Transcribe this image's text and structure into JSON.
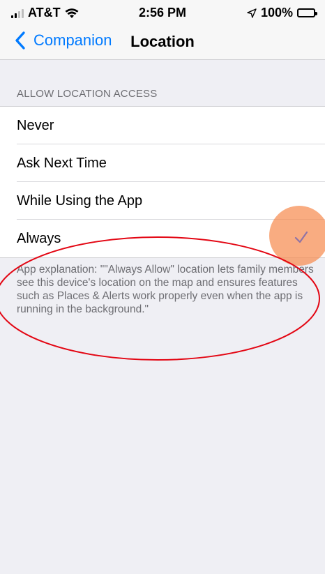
{
  "status_bar": {
    "carrier": "AT&T",
    "time": "2:56 PM",
    "battery": "100%",
    "icons": [
      "signal-icon",
      "wifi-icon",
      "location-arrow-icon",
      "battery-icon"
    ]
  },
  "nav": {
    "back_label": "Companion",
    "title": "Location"
  },
  "section": {
    "header": "ALLOW LOCATION ACCESS"
  },
  "options": [
    {
      "label": "Never",
      "selected": false
    },
    {
      "label": "Ask Next Time",
      "selected": false
    },
    {
      "label": "While Using the App",
      "selected": false
    },
    {
      "label": "Always",
      "selected": true
    }
  ],
  "footer": {
    "explanation": "App explanation: \"\"Always Allow\" location lets family members see this device's location on the map and ensures features such as Places & Alerts work properly even when the app is running in the background.\""
  },
  "colors": {
    "accent": "#007aff",
    "background": "#efeff4",
    "highlight": "#f68c50",
    "annotation": "#e30613",
    "battery": "#4cd964"
  }
}
